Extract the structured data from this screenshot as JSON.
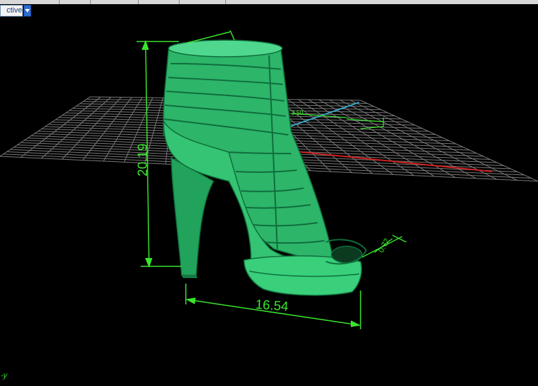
{
  "viewport": {
    "view_name": "ctive",
    "axis_label": "-y",
    "colors": {
      "background": "#000000",
      "grid": "#7a7a7a",
      "x_axis": "#d21f1f",
      "y_axis": "#39a8c8",
      "model": "#2db56a",
      "dimension": "#39e62d"
    }
  },
  "dimensions": {
    "height": "20.19",
    "length": "16.54",
    "top_width": "",
    "toe": "0.72",
    "small_value": "3.50"
  },
  "icons": {
    "view_menu": "chevron-down-icon"
  }
}
